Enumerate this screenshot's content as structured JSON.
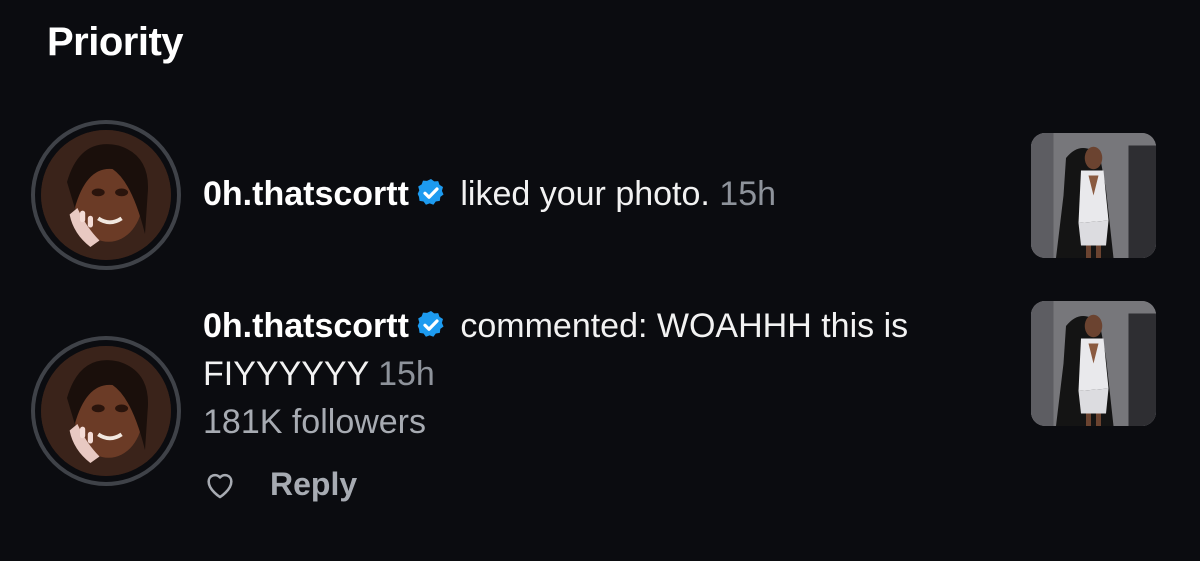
{
  "section": {
    "title": "Priority"
  },
  "notifications": [
    {
      "username": "0h.thatscortt",
      "verified_icon": "verified-badge-icon",
      "action_text": " liked your photo.",
      "time": " 15h"
    },
    {
      "username": "0h.thatscortt",
      "verified_icon": "verified-badge-icon",
      "action_text": " commented: WOAHHH this is FIYYYYYY",
      "time": " 15h",
      "followers": "181K followers",
      "reply_label": "Reply",
      "like_icon": "heart-outline-icon"
    }
  ],
  "colors": {
    "background": "#0b0c10",
    "verified": "#1d9bf0",
    "muted_text": "#8e939b"
  }
}
